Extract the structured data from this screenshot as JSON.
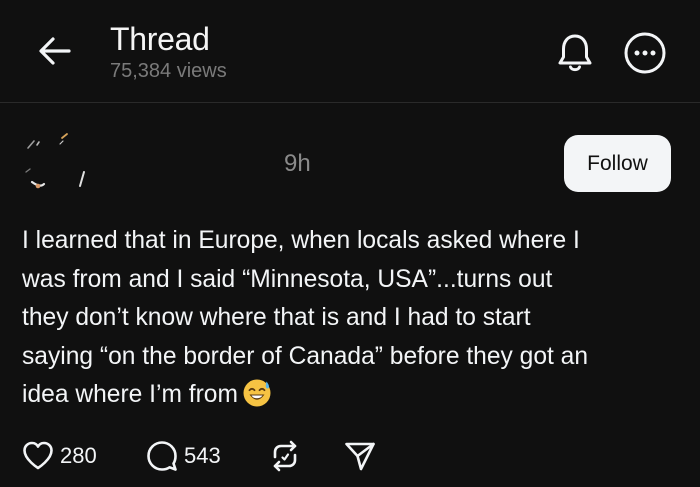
{
  "header": {
    "title": "Thread",
    "views": "75,384 views"
  },
  "post": {
    "time": "9h",
    "follow_label": "Follow",
    "text_lines": [
      "I learned that in Europe, when locals asked where I",
      "was from and I said “Minnesota, USA”...turns out",
      "they don’t know where that is and I had to start",
      "saying “on the border of Canada” before they got an",
      "idea where I’m from"
    ],
    "emoji": "sweat-smile-emoji"
  },
  "actions": {
    "likes": "280",
    "replies": "543"
  },
  "icons": {
    "back": "back-arrow-icon",
    "bell": "bell-icon",
    "more": "more-icon",
    "like": "heart-icon",
    "reply": "comment-icon",
    "repost": "repost-icon",
    "share": "share-icon"
  },
  "colors": {
    "background": "#101010",
    "text": "#f3f5f7",
    "muted": "#7a7a7a",
    "follow_bg": "#f3f5f7"
  }
}
